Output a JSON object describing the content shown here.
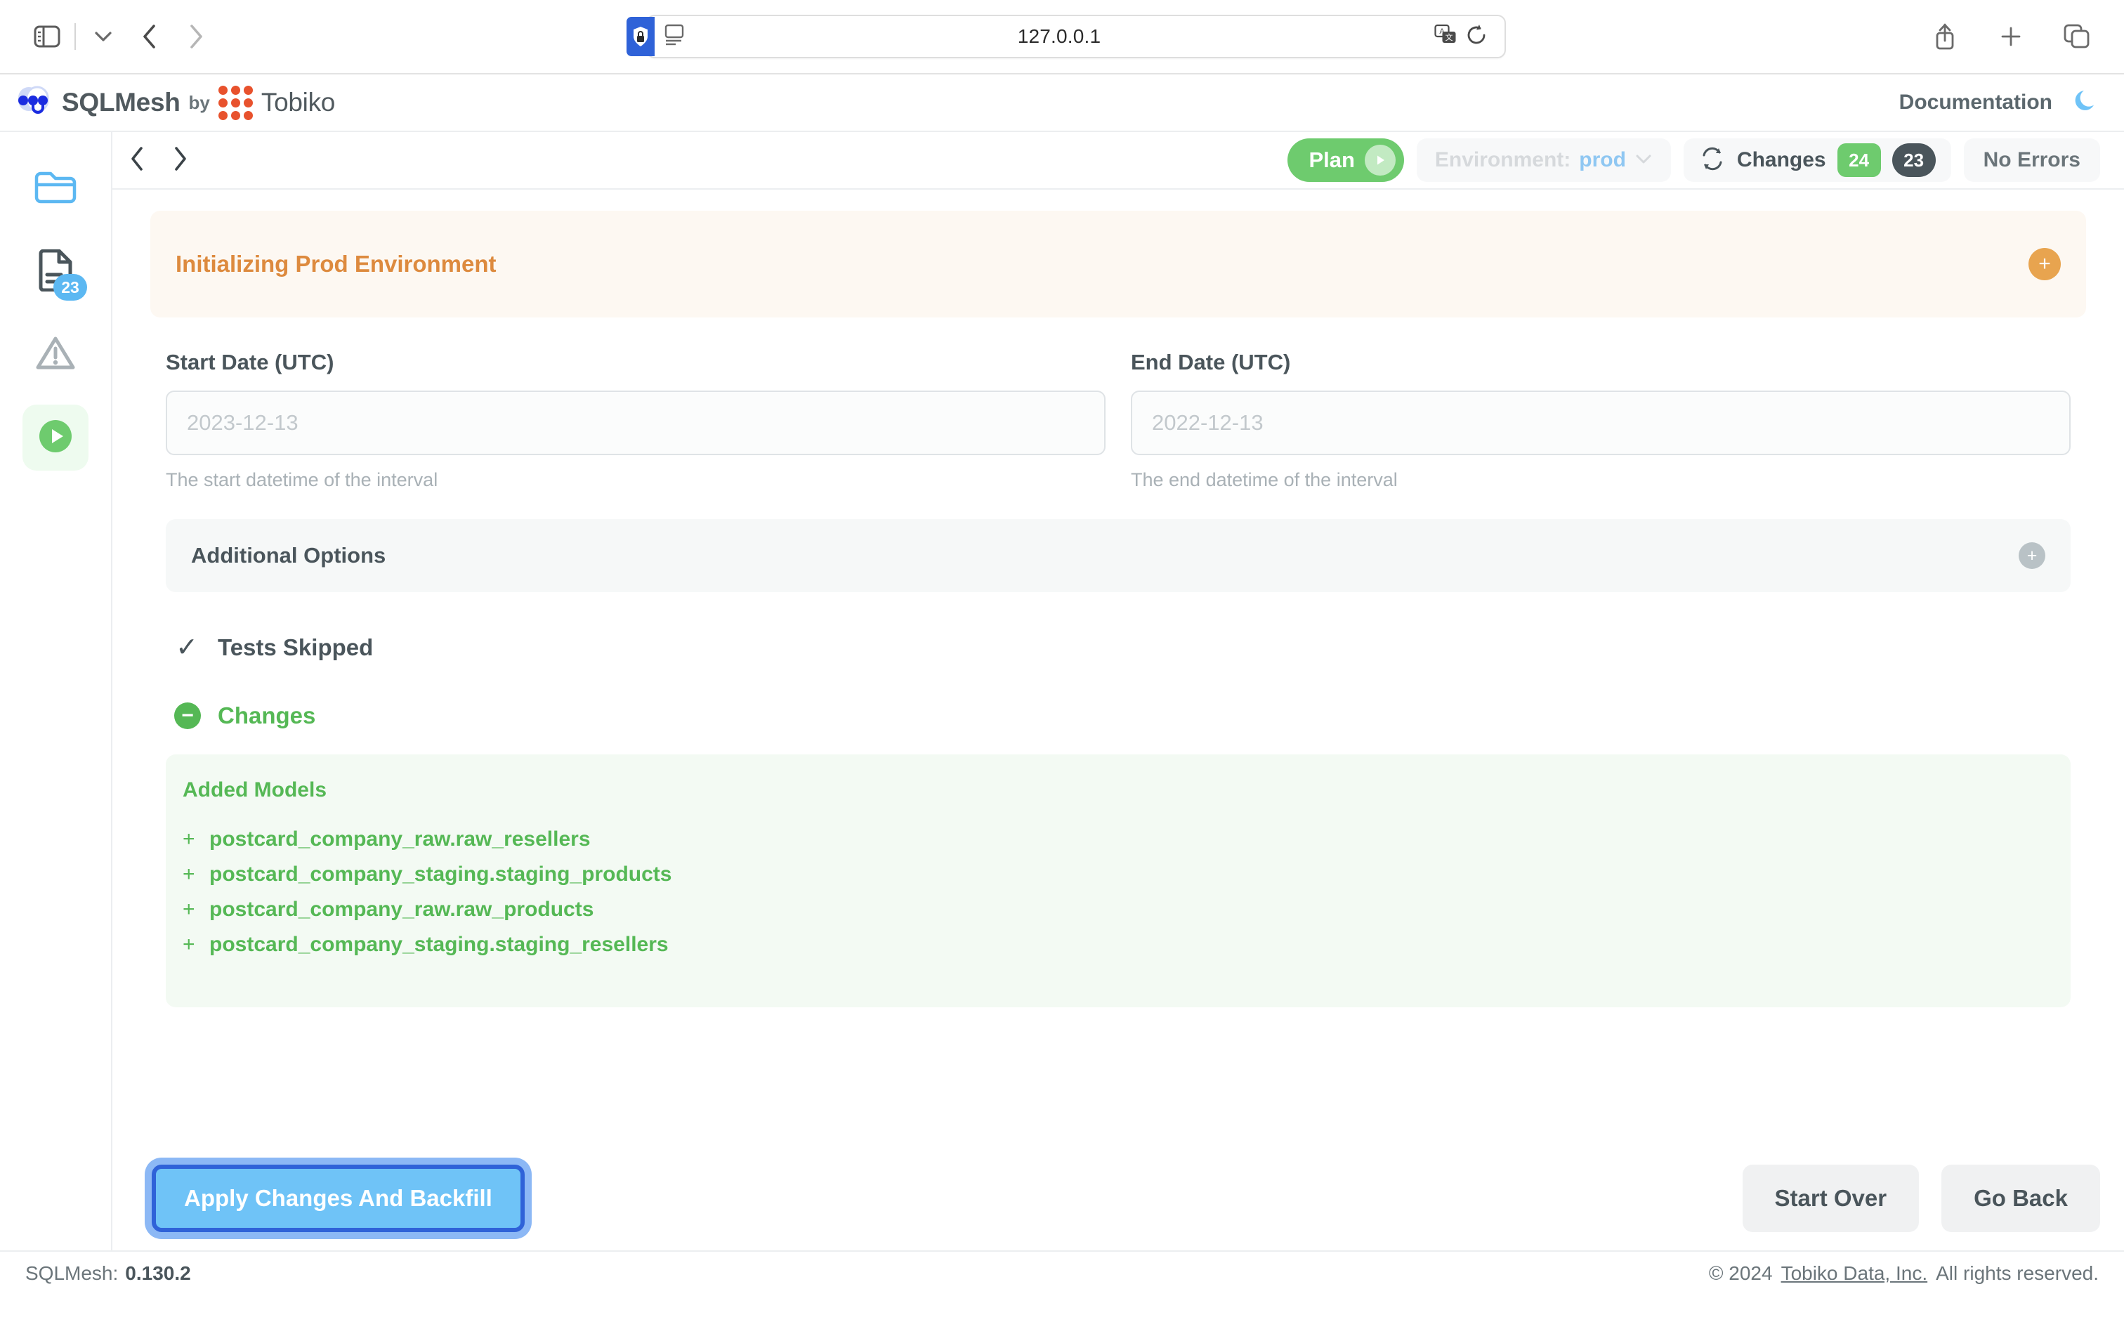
{
  "browser": {
    "url": "127.0.0.1",
    "icons": {
      "sidebar_toggle": "sidebar-toggle-icon",
      "tab_overview_chevron": "chevron-down-icon",
      "back": "back-arrow-icon",
      "forward": "forward-arrow-icon",
      "shield_lock": "shield-lock-icon",
      "reader": "reader-view-icon",
      "translate": "translate-icon",
      "reload": "reload-icon",
      "share": "share-icon",
      "new_tab": "plus-icon",
      "tabs": "tabs-overview-icon"
    }
  },
  "app_header": {
    "product": "SQLMesh",
    "by": "by",
    "company": "Tobiko",
    "documentation": "Documentation",
    "theme_toggle": "moon-icon"
  },
  "rail": {
    "items": [
      {
        "name": "files",
        "icon": "folder-icon",
        "active": false,
        "badge": null
      },
      {
        "name": "editor",
        "icon": "document-icon",
        "active": false,
        "badge": "23"
      },
      {
        "name": "errors",
        "icon": "warning-triangle-icon",
        "active": false,
        "badge": null
      },
      {
        "name": "plan",
        "icon": "play-circle-icon",
        "active": true,
        "badge": null
      }
    ]
  },
  "toolbar": {
    "back": "‹",
    "forward": "›",
    "plan_label": "Plan",
    "environment_label": "Environment:",
    "environment_value": "prod",
    "changes_label": "Changes",
    "changes_added": "24",
    "changes_total": "23",
    "errors_label": "No Errors"
  },
  "plan": {
    "banner_title": "Initializing Prod Environment",
    "banner_action": "+",
    "start_date": {
      "label": "Start Date (UTC)",
      "value": "",
      "placeholder": "2023-12-13",
      "help": "The start datetime of the interval"
    },
    "end_date": {
      "label": "End Date (UTC)",
      "value": "",
      "placeholder": "2022-12-13",
      "help": "The end datetime of the interval"
    },
    "additional_options": {
      "title": "Additional Options",
      "action": "+"
    },
    "tests": {
      "icon": "check-icon",
      "label": "Tests Skipped"
    },
    "changes_section": {
      "icon": "minus-circle-icon",
      "label": "Changes",
      "added_models_title": "Added Models",
      "added_models": [
        "postcard_company_raw.raw_resellers",
        "postcard_company_staging.staging_products",
        "postcard_company_raw.raw_products",
        "postcard_company_staging.staging_resellers"
      ]
    }
  },
  "actions": {
    "apply": "Apply Changes And Backfill",
    "start_over": "Start Over",
    "go_back": "Go Back"
  },
  "statusbar": {
    "product_label": "SQLMesh:",
    "version": "0.130.2",
    "copyright": "© 2024",
    "company_link": "Tobiko Data, Inc.",
    "rights": "All rights reserved."
  },
  "colors": {
    "accent_green": "#6ecb6e",
    "accent_blue": "#6fc3f7",
    "accent_orange": "#e8522d",
    "banner_orange": "#dd8a3e",
    "focus_blue": "#2f62d8"
  }
}
